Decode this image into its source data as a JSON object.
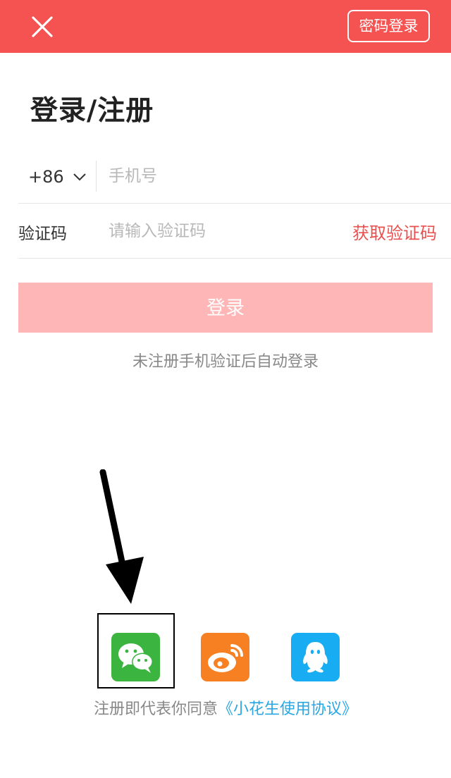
{
  "header": {
    "close_icon": "close-icon",
    "password_login_label": "密码登录",
    "background_color": "#f55252"
  },
  "page": {
    "title": "登录/注册"
  },
  "phone_row": {
    "country_code": "+86",
    "phone_placeholder": "手机号"
  },
  "code_row": {
    "label": "验证码",
    "code_placeholder": "请输入验证码",
    "get_code_label": "获取验证码",
    "get_code_color": "#e8514f"
  },
  "login": {
    "button_label": "登录",
    "button_color": "#ffb6b6",
    "hint": "未注册手机验证后自动登录"
  },
  "social": {
    "items": [
      {
        "name": "wechat",
        "icon": "wechat-icon",
        "color": "#3bb540"
      },
      {
        "name": "weibo",
        "icon": "weibo-icon",
        "color": "#f68022"
      },
      {
        "name": "qq",
        "icon": "qq-icon",
        "color": "#18acf2"
      }
    ]
  },
  "agreement": {
    "prefix": "注册即代表你同意",
    "link": "《小花生使用协议》",
    "link_color": "#2aa7e3"
  },
  "annotation": {
    "arrow_icon": "arrow-down-icon",
    "highlight": "highlight-box"
  }
}
